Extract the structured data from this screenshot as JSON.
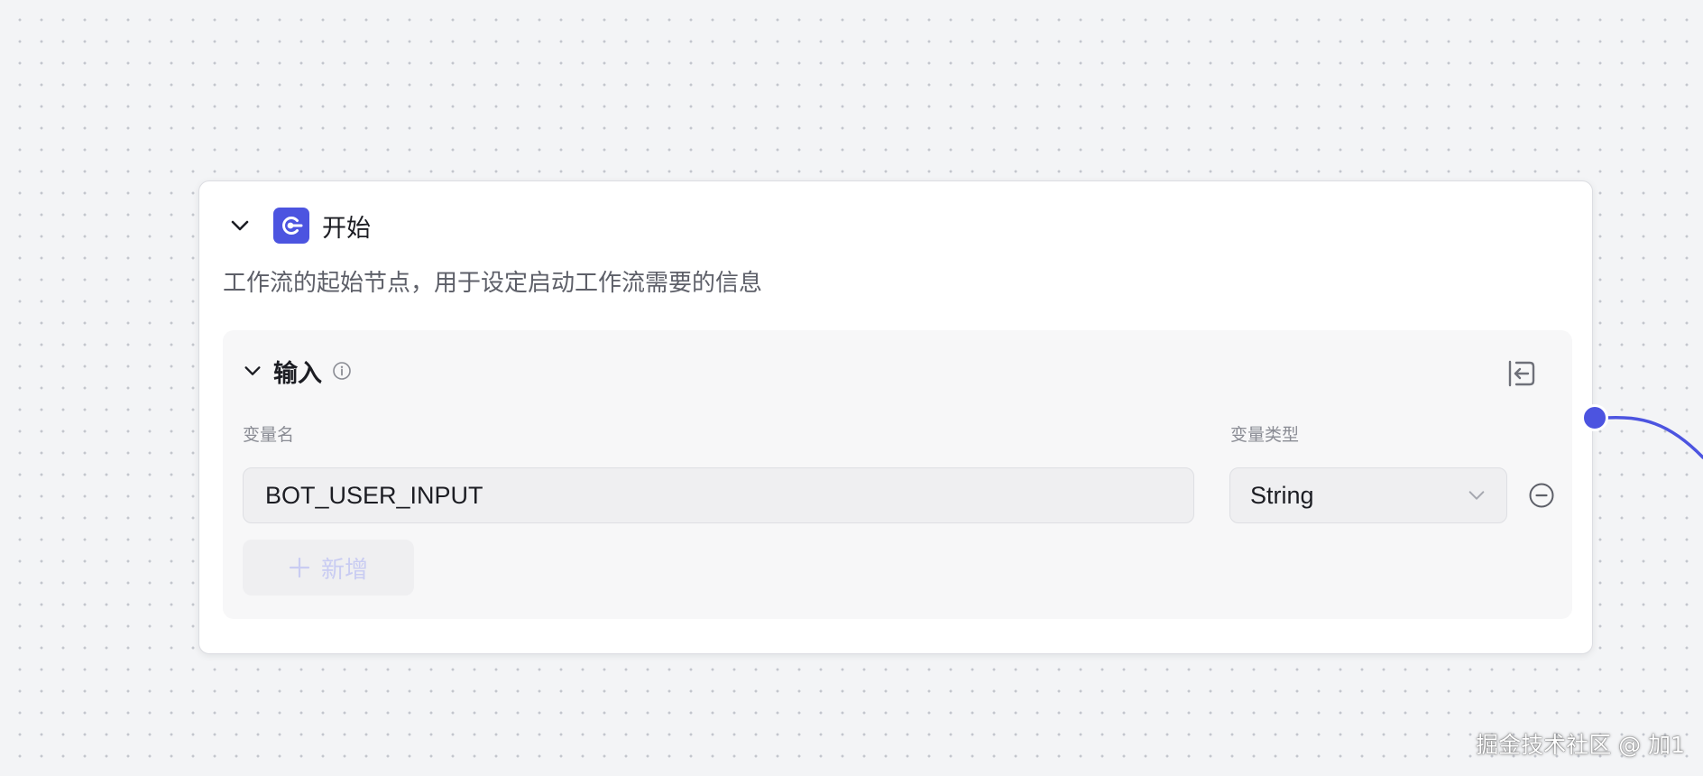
{
  "node": {
    "title": "开始",
    "description": "工作流的起始节点，用于设定启动工作流需要的信息",
    "icon": "workflow-start-icon",
    "accent_color": "#4c54e0"
  },
  "input_section": {
    "title": "输入",
    "columns": {
      "name_label": "变量名",
      "type_label": "变量类型"
    },
    "variables": [
      {
        "name": "BOT_USER_INPUT",
        "type": "String"
      }
    ],
    "add_button_label": "新增"
  },
  "watermark": "掘金技术社区 @ 加1"
}
